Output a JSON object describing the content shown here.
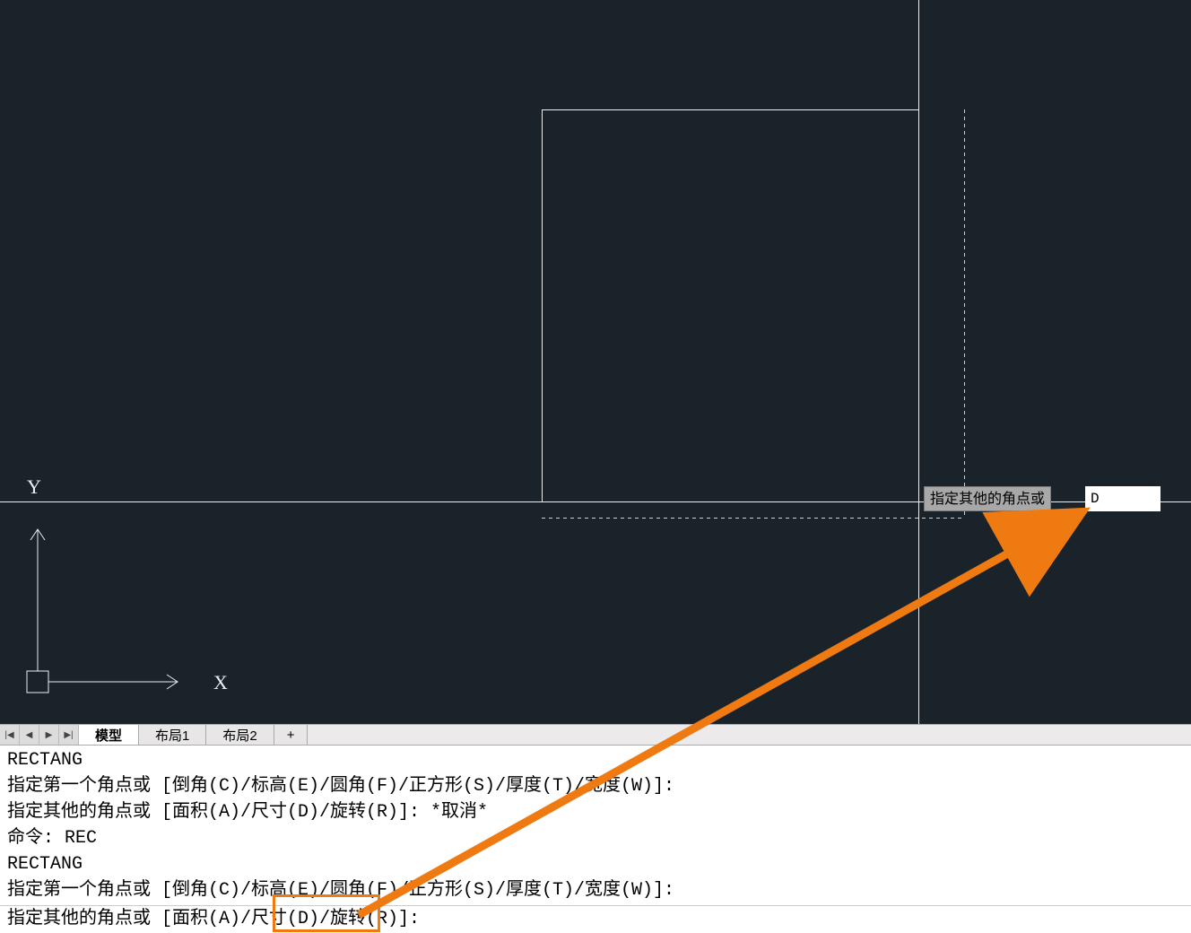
{
  "canvas": {
    "dynamic_prompt_label": "指定其他的角点或",
    "dynamic_input_value": "D",
    "ucs": {
      "x_label": "X",
      "y_label": "Y"
    }
  },
  "tabs": {
    "nav": {
      "first": "|◀",
      "prev": "◀",
      "next": "▶",
      "last": "▶|"
    },
    "items": [
      {
        "label": "模型",
        "active": true
      },
      {
        "label": "布局1",
        "active": false
      },
      {
        "label": "布局2",
        "active": false
      }
    ],
    "add_label": "+"
  },
  "command_history": [
    "RECTANG",
    "指定第一个角点或 [倒角(C)/标高(E)/圆角(F)/正方形(S)/厚度(T)/宽度(W)]:",
    "指定其他的角点或 [面积(A)/尺寸(D)/旋转(R)]: *取消*",
    "命令: REC",
    "RECTANG",
    "指定第一个角点或 [倒角(C)/标高(E)/圆角(F)/正方形(S)/厚度(T)/宽度(W)]:"
  ],
  "command_line": {
    "prompt": "指定其他的角点或 [面积(A)/尺寸(D)/旋转(R)]:",
    "input_value": ""
  },
  "annotation": {
    "highlight_target": "尺寸(D)"
  }
}
